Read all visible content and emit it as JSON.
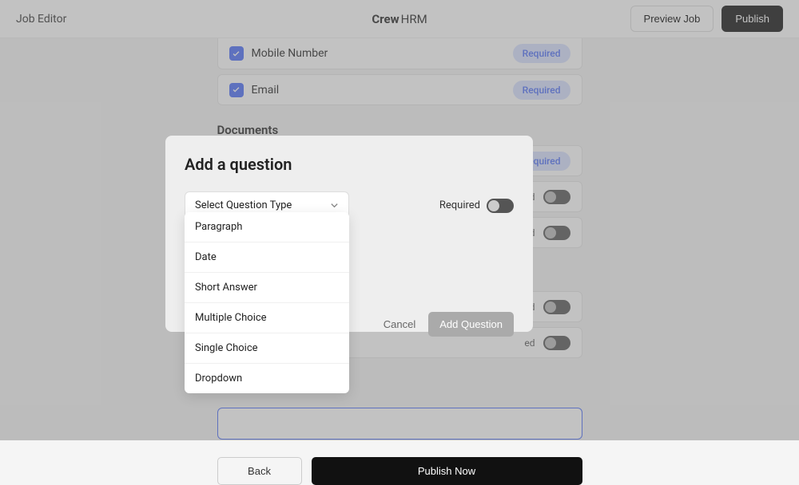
{
  "header": {
    "title": "Job Editor",
    "brand_crew": "Crew",
    "brand_hrm": "HRM",
    "preview_label": "Preview Job",
    "publish_label": "Publish"
  },
  "fields": {
    "mobile_label": "Mobile Number",
    "email_label": "Email"
  },
  "badge_required": "Required",
  "section_documents": "Documents",
  "doc_rows": {
    "row1_badge": "Required",
    "row2_label": "ed",
    "row3_label": "ed",
    "row4_label": "ed",
    "row5_label": "ed"
  },
  "footer": {
    "back": "Back",
    "publish_now": "Publish Now"
  },
  "modal": {
    "title": "Add a question",
    "select_label": "Select Question Type",
    "required_label": "Required",
    "cancel": "Cancel",
    "add_question": "Add Question"
  },
  "dropdown_options": {
    "opt1": "Paragraph",
    "opt2": "Date",
    "opt3": "Short Answer",
    "opt4": "Multiple Choice",
    "opt5": "Single Choice",
    "opt6": "Dropdown"
  }
}
